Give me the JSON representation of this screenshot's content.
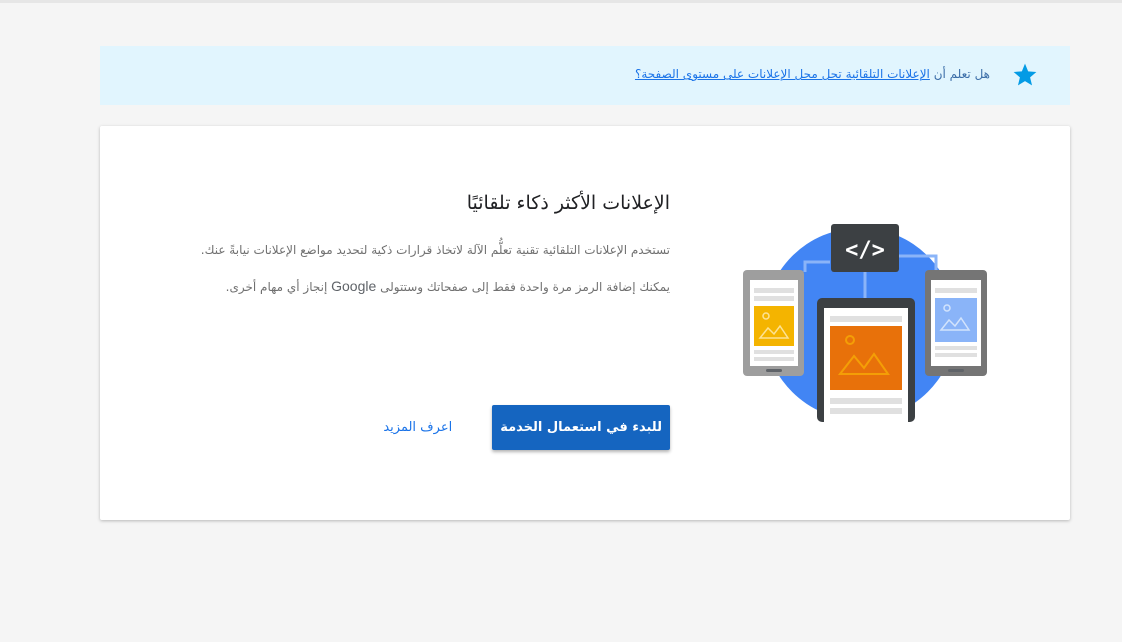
{
  "banner": {
    "prefix": "هل تعلم أن",
    "link": "الإعلانات التلقائية تحل محل الإعلانات على مستوى الصفحة؟",
    "star_color": "#039be5"
  },
  "card": {
    "title": "الإعلانات الأكثر ذكاء تلقائيًا",
    "description": "تستخدم الإعلانات التلقائية تقنية تعلُّم الآلة لاتخاذ قرارات ذكية لتحديد مواضع الإعلانات نيابةً عنك.",
    "description2_before": "يمكنك إضافة الرمز مرة واحدة فقط إلى صفحاتك وستتولى",
    "brand": "Google",
    "description2_after": "إنجاز أي مهام أخرى.",
    "code_icon_text": "</>"
  },
  "actions": {
    "primary_label": "للبدء في استعمال الخدمة",
    "secondary_label": "اعرف المزيد"
  },
  "colors": {
    "primary": "#1565c0",
    "link": "#1a73e8",
    "banner_bg": "#e1f5fe",
    "circle": "#4285f4"
  }
}
